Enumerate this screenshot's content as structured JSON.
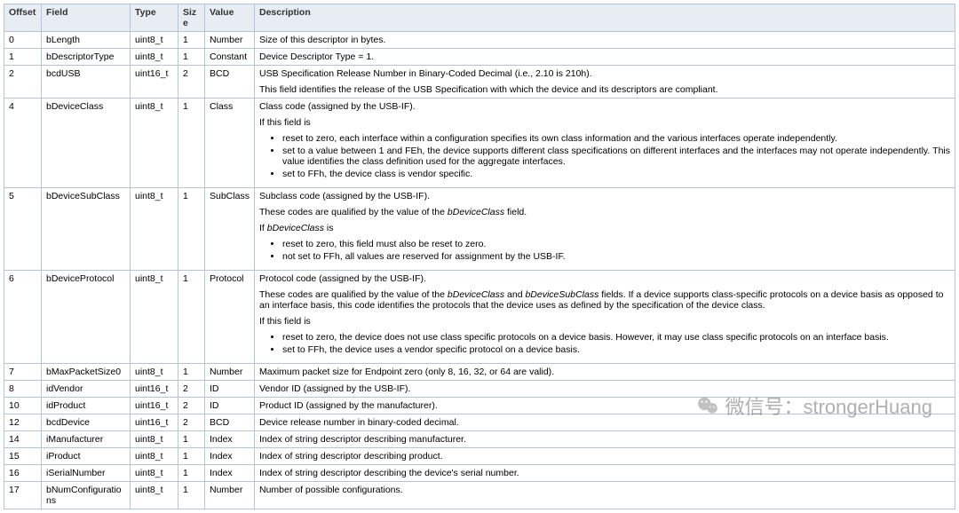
{
  "headers": {
    "offset": "Offset",
    "field": "Field",
    "type": "Type",
    "size": "Size",
    "value": "Value",
    "description": "Description"
  },
  "rows": [
    {
      "offset": "0",
      "field": "bLength",
      "type": "uint8_t",
      "size": "1",
      "value": "Number",
      "description": [
        {
          "kind": "p",
          "text": "Size of this descriptor in bytes."
        }
      ]
    },
    {
      "offset": "1",
      "field": "bDescriptorType",
      "type": "uint8_t",
      "size": "1",
      "value": "Constant",
      "description": [
        {
          "kind": "p",
          "text": "Device Descriptor Type = 1."
        }
      ]
    },
    {
      "offset": "2",
      "field": "bcdUSB",
      "type": "uint16_t",
      "size": "2",
      "value": "BCD",
      "description": [
        {
          "kind": "p",
          "text": "USB Specification Release Number in Binary-Coded Decimal (i.e., 2.10 is 210h)."
        },
        {
          "kind": "p",
          "text": "This field identifies the release of the USB Specification with which the device and its descriptors are compliant."
        }
      ]
    },
    {
      "offset": "4",
      "field": "bDeviceClass",
      "type": "uint8_t",
      "size": "1",
      "value": "Class",
      "description": [
        {
          "kind": "p",
          "text": "Class code (assigned by the USB-IF)."
        },
        {
          "kind": "p",
          "text": "If this field is"
        },
        {
          "kind": "ul",
          "items": [
            "reset to zero, each interface within a configuration specifies its own class information and the various interfaces operate independently.",
            "set to a value between 1 and FEh, the device supports different class specifications on different interfaces and the interfaces may not operate independently. This value identifies the class definition used for the aggregate interfaces.",
            "set to FFh, the device class is vendor specific."
          ]
        }
      ]
    },
    {
      "offset": "5",
      "field": "bDeviceSubClass",
      "type": "uint8_t",
      "size": "1",
      "value": "SubClass",
      "description": [
        {
          "kind": "p",
          "text": "Subclass code (assigned by the USB-IF)."
        },
        {
          "kind": "p",
          "html": "These codes are qualified by the value of the <em>bDeviceClass</em> field."
        },
        {
          "kind": "p",
          "html": "If <em>bDeviceClass</em> is"
        },
        {
          "kind": "ul",
          "items": [
            "reset to zero, this field must also be reset to zero.",
            "not set to FFh, all values are reserved for assignment by the USB-IF."
          ]
        }
      ]
    },
    {
      "offset": "6",
      "field": "bDeviceProtocol",
      "type": "uint8_t",
      "size": "1",
      "value": "Protocol",
      "description": [
        {
          "kind": "p",
          "text": "Protocol code (assigned by the USB-IF)."
        },
        {
          "kind": "p",
          "html": "These codes are qualified by the value of the <em>bDeviceClass</em> and <em>bDeviceSubClass</em> fields. If a device supports class-specific protocols on a device basis as opposed to an interface basis, this code identifies the protocols that the device uses as defined by the specification of the device class."
        },
        {
          "kind": "p",
          "text": "If this field is"
        },
        {
          "kind": "ul",
          "items": [
            "reset to zero, the device does not use class specific protocols on a device basis. However, it may use class specific protocols on an interface basis.",
            "set to FFh, the device uses a vendor specific protocol on a device basis."
          ]
        }
      ]
    },
    {
      "offset": "7",
      "field": "bMaxPacketSize0",
      "type": "uint8_t",
      "size": "1",
      "value": "Number",
      "description": [
        {
          "kind": "p",
          "text": "Maximum packet size for Endpoint zero (only 8, 16, 32, or 64 are valid)."
        }
      ]
    },
    {
      "offset": "8",
      "field": "idVendor",
      "type": "uint16_t",
      "size": "2",
      "value": "ID",
      "description": [
        {
          "kind": "p",
          "text": "Vendor ID (assigned by the USB-IF)."
        }
      ]
    },
    {
      "offset": "10",
      "field": "idProduct",
      "type": "uint16_t",
      "size": "2",
      "value": "ID",
      "description": [
        {
          "kind": "p",
          "text": "Product ID (assigned by the manufacturer)."
        }
      ]
    },
    {
      "offset": "12",
      "field": "bcdDevice",
      "type": "uint16_t",
      "size": "2",
      "value": "BCD",
      "description": [
        {
          "kind": "p",
          "text": "Device release number in binary-coded decimal."
        }
      ]
    },
    {
      "offset": "14",
      "field": "iManufacturer",
      "type": "uint8_t",
      "size": "1",
      "value": "Index",
      "description": [
        {
          "kind": "p",
          "text": "Index of string descriptor describing manufacturer."
        }
      ]
    },
    {
      "offset": "15",
      "field": "iProduct",
      "type": "uint8_t",
      "size": "1",
      "value": "Index",
      "description": [
        {
          "kind": "p",
          "text": "Index of string descriptor describing product."
        }
      ]
    },
    {
      "offset": "16",
      "field": "iSerialNumber",
      "type": "uint8_t",
      "size": "1",
      "value": "Index",
      "description": [
        {
          "kind": "p",
          "text": "Index of string descriptor describing the device's serial number."
        }
      ]
    },
    {
      "offset": "17",
      "field": "bNumConfigurations",
      "type": "uint8_t",
      "size": "1",
      "value": "Number",
      "description": [
        {
          "kind": "p",
          "text": "Number of possible configurations."
        }
      ]
    }
  ],
  "watermark": {
    "label_cn": "微信号：",
    "handle": "strongerHuang"
  }
}
